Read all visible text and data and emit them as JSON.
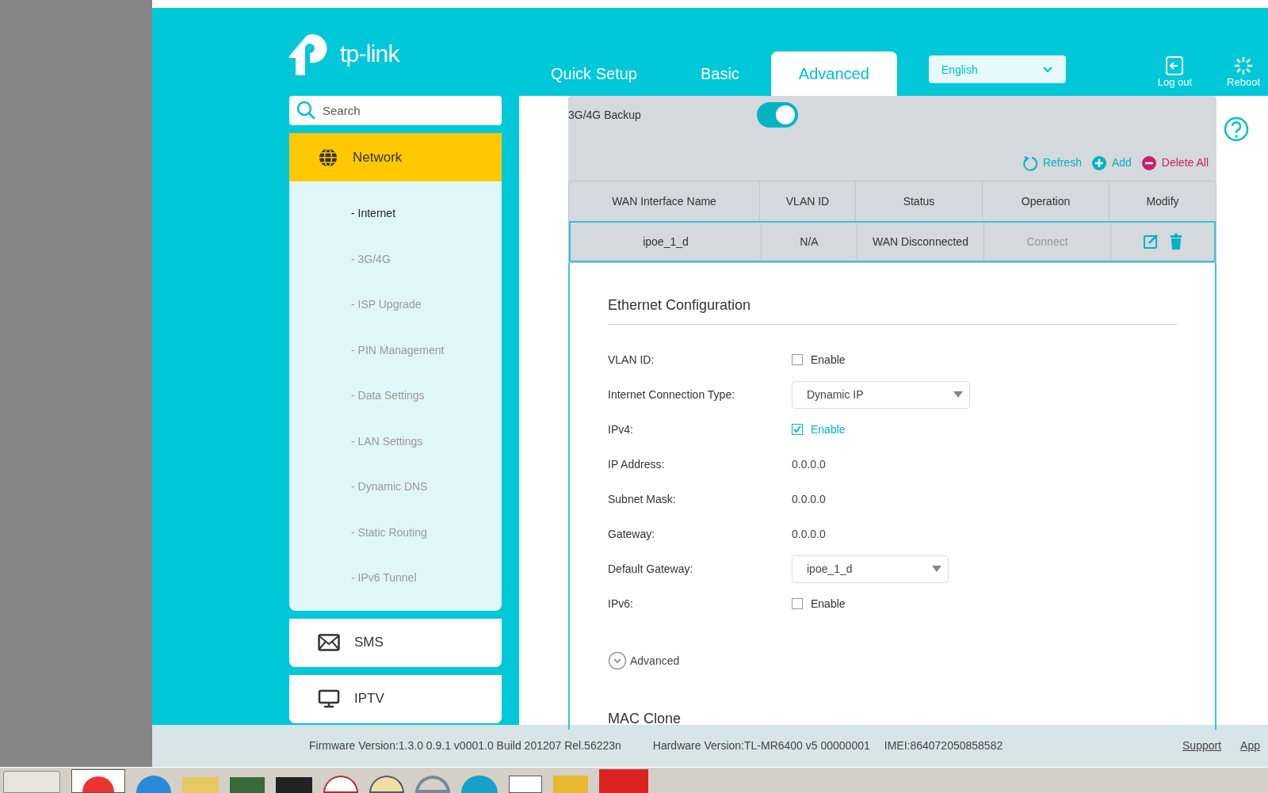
{
  "brand": {
    "name": "tp-link"
  },
  "nav_tabs": [
    {
      "label": "Quick Setup",
      "selected": false
    },
    {
      "label": "Basic",
      "selected": false
    },
    {
      "label": "Advanced",
      "selected": true
    }
  ],
  "language": {
    "value": "English"
  },
  "header_actions": [
    {
      "kind": "logout",
      "label": "Log out"
    },
    {
      "kind": "reboot",
      "label": "Reboot"
    }
  ],
  "search": {
    "placeholder": "Search"
  },
  "sidebar": {
    "items": [
      {
        "kind": "network",
        "label": "Network",
        "expanded": true,
        "children": [
          {
            "label": "- Internet",
            "selected": true
          },
          {
            "label": "- 3G/4G",
            "selected": false
          },
          {
            "label": "- ISP Upgrade",
            "selected": false
          },
          {
            "label": "- PIN Management",
            "selected": false
          },
          {
            "label": "- Data Settings",
            "selected": false
          },
          {
            "label": "- LAN Settings",
            "selected": false
          },
          {
            "label": "- Dynamic DNS",
            "selected": false
          },
          {
            "label": "- Static Routing",
            "selected": false
          },
          {
            "label": "- IPv6 Tunnel",
            "selected": false
          }
        ]
      },
      {
        "kind": "sms",
        "label": "SMS",
        "expanded": false
      },
      {
        "kind": "iptv",
        "label": "IPTV",
        "expanded": false
      }
    ]
  },
  "backup": {
    "label": "3G/4G Backup",
    "on": true
  },
  "table_actions": [
    {
      "kind": "refresh",
      "label": "Refresh"
    },
    {
      "kind": "add",
      "label": "Add"
    },
    {
      "kind": "delete",
      "label": "Delete All"
    }
  ],
  "table": {
    "columns": [
      "WAN Interface Name",
      "VLAN ID",
      "Status",
      "Operation",
      "Modify"
    ],
    "rows": [
      {
        "name": "ipoe_1_d",
        "vlan_id": "N/A",
        "status": "WAN Disconnected",
        "operation": "Connect"
      }
    ]
  },
  "ethernet": {
    "title": "Ethernet Configuration",
    "fields": [
      {
        "kind": "checkbox",
        "label": "VLAN ID:",
        "text": "Enable",
        "checked": false
      },
      {
        "kind": "select",
        "label": "Internet Connection Type:",
        "value": "Dynamic IP"
      },
      {
        "kind": "checkbox",
        "label": "IPv4:",
        "text": "Enable",
        "checked": true
      },
      {
        "kind": "text",
        "label": "IP Address:",
        "value": "0.0.0.0"
      },
      {
        "kind": "text",
        "label": "Subnet Mask:",
        "value": "0.0.0.0"
      },
      {
        "kind": "text",
        "label": "Gateway:",
        "value": "0.0.0.0"
      },
      {
        "kind": "select",
        "label": "Default Gateway:",
        "value": "ipoe_1_d"
      },
      {
        "kind": "checkbox",
        "label": "IPv6:",
        "text": "Enable",
        "checked": false
      }
    ],
    "advanced": "Advanced"
  },
  "mac_clone": {
    "title": "MAC Clone"
  },
  "footer": {
    "firmware": "Firmware Version:1.3.0 0.9.1 v0001.0 Build 201207 Rel.56223n",
    "hardware": "Hardware Version:TL-MR6400 v5 00000001",
    "imei": "IMEI:864072050858582",
    "links": [
      "Support",
      "App"
    ]
  }
}
